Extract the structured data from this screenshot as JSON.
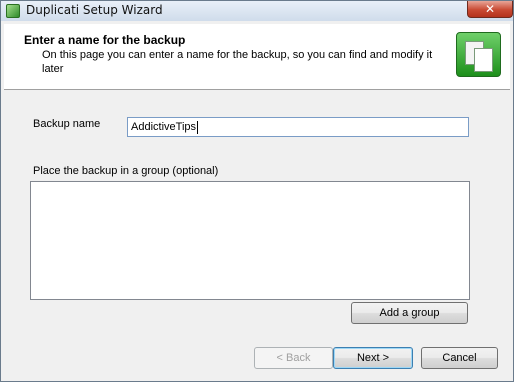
{
  "window": {
    "title": "Duplicati Setup Wizard",
    "close_glyph": "✕"
  },
  "header": {
    "title": "Enter a name for the backup",
    "description": "On this page you can enter a name for the backup, so you can find and modify it later",
    "icon": "backup-documents-icon"
  },
  "form": {
    "backup_name_label": "Backup name",
    "backup_name_value": "AddictiveTips",
    "group_label": "Place the backup in a group (optional)",
    "add_group_label": "Add a group"
  },
  "buttons": {
    "back": "< Back",
    "next": "Next >",
    "cancel": "Cancel"
  }
}
